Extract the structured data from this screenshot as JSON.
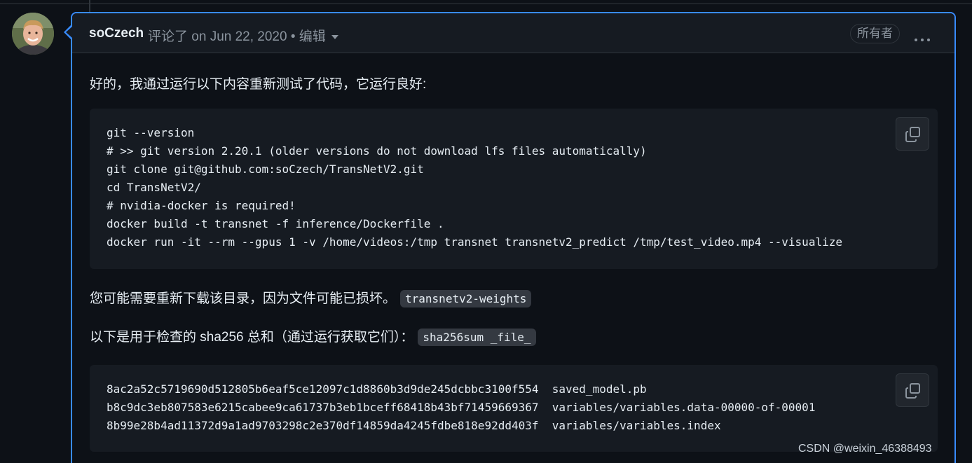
{
  "comment": {
    "author": "soCzech",
    "meta_text": "评论了 on Jun 22, 2020 • 编辑",
    "owner_badge": "所有者",
    "intro_text": "好的，我通过运行以下内容重新测试了代码，它运行良好:",
    "code_block_1": "git --version\n# >> git version 2.20.1 (older versions do not download lfs files automatically)\ngit clone git@github.com:soCzech/TransNetV2.git\ncd TransNetV2/\n# nvidia-docker is required!\ndocker build -t transnet -f inference/Dockerfile .\ndocker run -it --rm --gpus 1 -v /home/videos:/tmp transnet transnetv2_predict /tmp/test_video.mp4 --visualize",
    "redownload_text": "您可能需要重新下载该目录，因为文件可能已损坏。",
    "redownload_code": "transnetv2-weights",
    "sha_text": "以下是用于检查的 sha256 总和（通过运行获取它们）：",
    "sha_code": "sha256sum _file_",
    "code_block_2": "8ac2a52c5719690d512805b6eaf5ce12097c1d8860b3d9de245dcbbc3100f554  saved_model.pb\nb8c9dc3eb807583e6215cabee9ca61737b3eb1bceff68418b43bf71459669367  variables/variables.data-00000-of-00001\n8b99e28b4ad11372d9a1ad9703298c2e370df14859da4245fdbe818e92dd403f  variables/variables.index"
  },
  "watermark": "CSDN @weixin_46388493",
  "icons": {
    "avatar": "user-avatar",
    "menu": "kebab-horizontal-icon",
    "caret": "triangle-down-icon",
    "copy": "copy-icon"
  },
  "colors": {
    "background": "#0d1117",
    "accent_border": "#388bfd",
    "header_bg": "#161b22",
    "muted_text": "#8b949e"
  }
}
